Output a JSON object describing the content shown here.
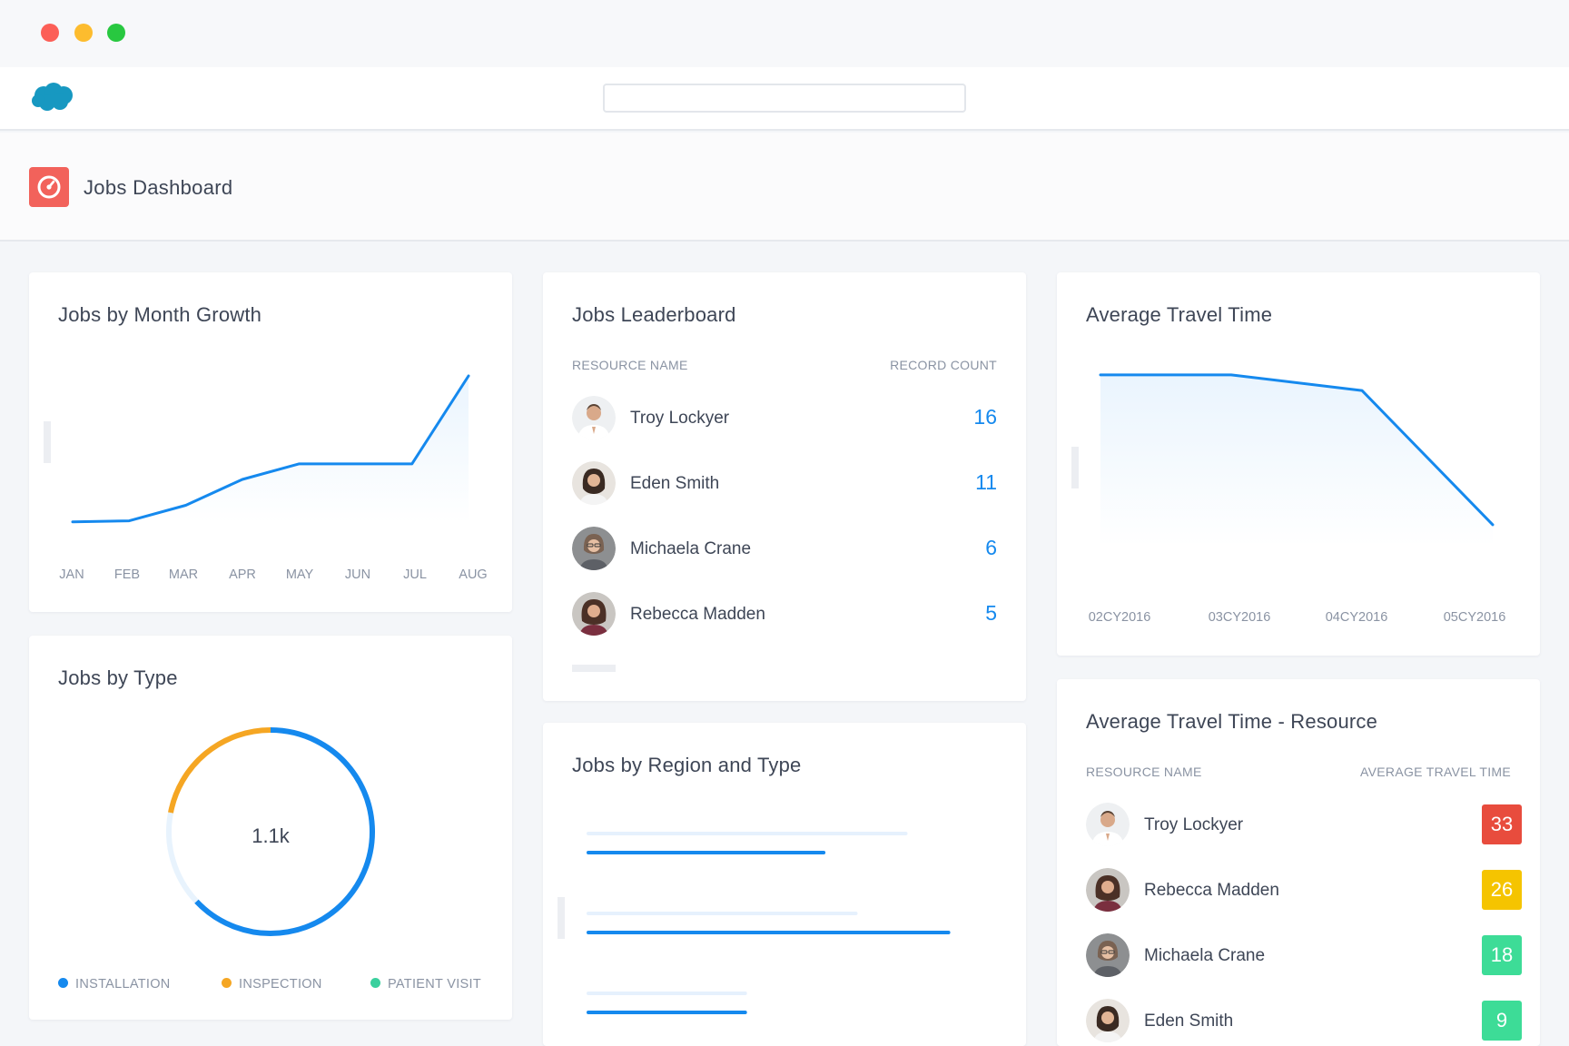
{
  "page": {
    "title": "Jobs Dashboard",
    "search_placeholder": ""
  },
  "colors": {
    "accent_blue": "#1589ee",
    "page_icon": "#f2625b",
    "installation": "#1589ee",
    "inspection": "#f5a623",
    "patient_visit": "#3ad09e",
    "badge_red": "#e84c3d",
    "badge_yellow": "#f5c400",
    "badge_green": "#3ddc97"
  },
  "cards": {
    "jobs_by_month": {
      "title": "Jobs by Month Growth"
    },
    "jobs_by_type": {
      "title": "Jobs by Type",
      "center_value": "1.1k"
    },
    "leaderboard": {
      "title": "Jobs Leaderboard",
      "col_name": "RESOURCE NAME",
      "col_count": "RECORD COUNT",
      "rows": [
        {
          "name": "Troy Lockyer",
          "count": "16"
        },
        {
          "name": "Eden Smith",
          "count": "11"
        },
        {
          "name": "Michaela Crane",
          "count": "6"
        },
        {
          "name": "Rebecca Madden",
          "count": "5"
        }
      ]
    },
    "region_type": {
      "title": "Jobs by Region and Type"
    },
    "avg_travel": {
      "title": "Average Travel Time"
    },
    "avg_travel_resource": {
      "title": "Average Travel Time - Resource",
      "col_name": "RESOURCE NAME",
      "col_time": "AVERAGE TRAVEL TIME",
      "rows": [
        {
          "name": "Troy Lockyer",
          "value": "33",
          "color": "#e84c3d"
        },
        {
          "name": "Rebecca Madden",
          "value": "26",
          "color": "#f5c400"
        },
        {
          "name": "Michaela Crane",
          "value": "18",
          "color": "#3ddc97"
        },
        {
          "name": "Eden Smith",
          "value": "9",
          "color": "#3ddc97"
        }
      ]
    }
  },
  "chart_data": [
    {
      "type": "area",
      "title": "Jobs by Month Growth",
      "categories": [
        "JAN",
        "FEB",
        "MAR",
        "APR",
        "MAY",
        "JUN",
        "JUL",
        "AUG"
      ],
      "values": [
        2,
        3,
        18,
        43,
        58,
        58,
        58,
        143
      ],
      "ylim": [
        0,
        150
      ],
      "grid": false
    },
    {
      "type": "pie",
      "title": "Jobs by Type",
      "center_label": "1.1k",
      "legend_position": "bottom",
      "series": [
        {
          "name": "INSTALLATION",
          "value": 63,
          "color": "#1589ee"
        },
        {
          "name": "PATIENT VISIT",
          "value": 15,
          "color": "#e8f3fd"
        },
        {
          "name": "INSPECTION",
          "value": 22,
          "color": "#f5a623"
        }
      ]
    },
    {
      "type": "area",
      "title": "Average Travel Time",
      "categories": [
        "02CY2016",
        "03CY2016",
        "04CY2016",
        "05CY2016"
      ],
      "values": [
        60,
        60,
        55,
        12
      ],
      "ylim": [
        5,
        62
      ],
      "grid": false
    },
    {
      "type": "bar",
      "title": "Jobs by Region and Type",
      "orientation": "horizontal",
      "categories": [
        "",
        "",
        ""
      ],
      "series": [
        {
          "values": [
            90,
            76,
            45
          ],
          "color": "#e6f1fd"
        },
        {
          "values": [
            67,
            102,
            45
          ],
          "color": "#1589ee"
        }
      ],
      "xlim": [
        0,
        110
      ],
      "grid": false
    }
  ]
}
